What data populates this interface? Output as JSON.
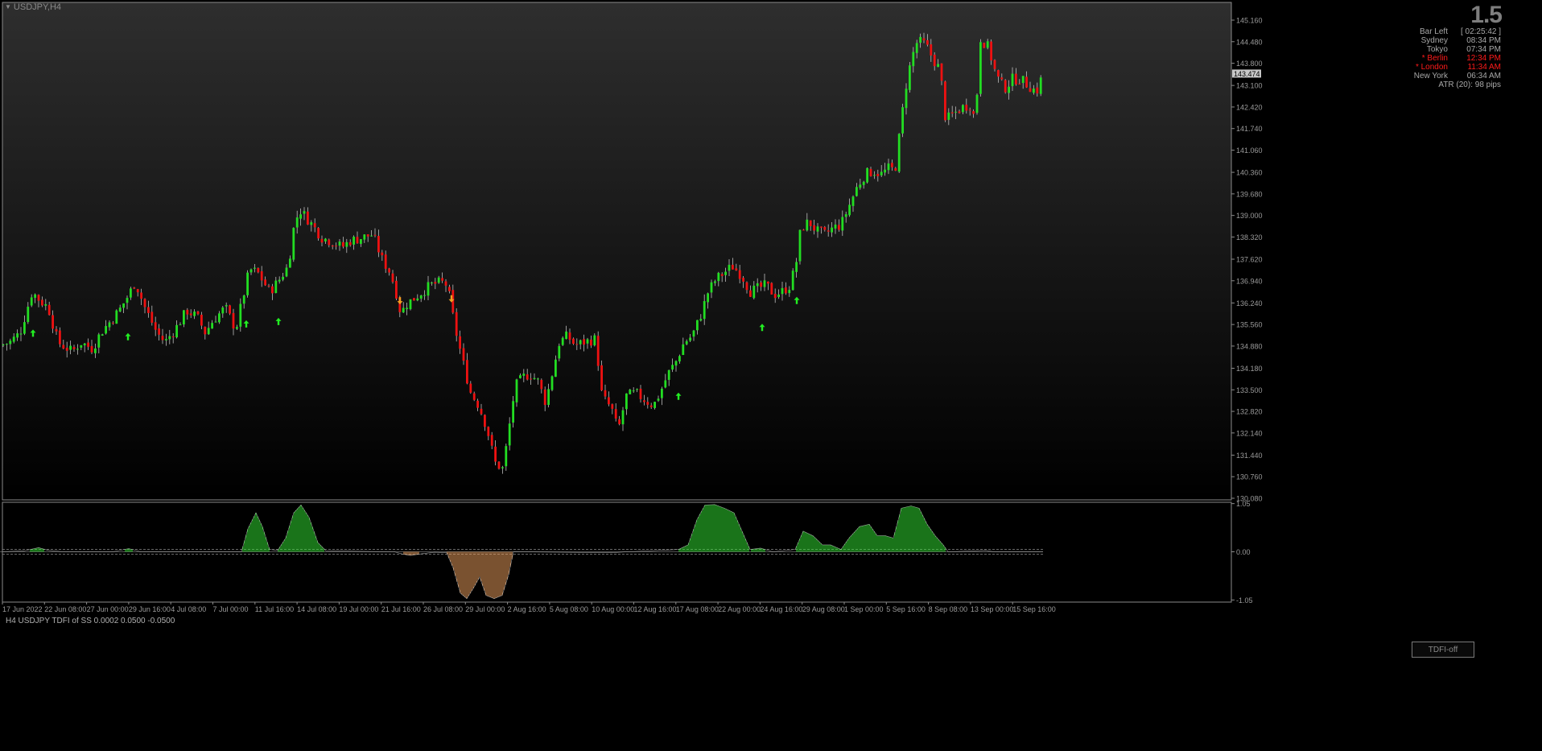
{
  "window": {
    "title": "USDJPY,H4",
    "title_icon": "dropdown-triangle-icon",
    "spread": "1.5"
  },
  "info_panel": {
    "rows": [
      {
        "label": "Bar Left",
        "value": "[ 02:25:42 ]",
        "color": "#a8a8a8"
      },
      {
        "label": "Sydney",
        "value": "08:34 PM",
        "color": "#a8a8a8"
      },
      {
        "label": "Tokyo",
        "value": "07:34 PM",
        "color": "#a8a8a8"
      },
      {
        "label": "* Berlin",
        "value": "12:34 PM",
        "color": "#ff1a1a"
      },
      {
        "label": "* London",
        "value": "11:34 AM",
        "color": "#ff1a1a"
      },
      {
        "label": "New York",
        "value": "06:34 AM",
        "color": "#a8a8a8"
      }
    ],
    "atr": "ATR (20): 98 pips"
  },
  "price_axis": {
    "labels": [
      "145.160",
      "144.480",
      "143.800",
      "143.100",
      "142.420",
      "141.740",
      "141.060",
      "140.360",
      "139.680",
      "139.000",
      "138.320",
      "137.620",
      "136.940",
      "136.240",
      "135.560",
      "134.880",
      "134.180",
      "133.500",
      "132.820",
      "132.140",
      "131.440",
      "130.760",
      "130.080"
    ],
    "current_price": "143.474"
  },
  "indicator": {
    "label": "H4 USDJPY TDFI of SS 0.0002 0.0500 -0.0500",
    "axis_labels": [
      "1.05",
      "0.00",
      "-1.05"
    ],
    "button_label": "TDFI-off",
    "positive_color": "#33e833",
    "negative_color": "#f4a460"
  },
  "time_axis": {
    "labels": [
      "17 Jun 2022",
      "22 Jun 08:00",
      "27 Jun 00:00",
      "29 Jun 16:00",
      "4 Jul 08:00",
      "7 Jul 00:00",
      "11 Jul 16:00",
      "14 Jul 08:00",
      "19 Jul 00:00",
      "21 Jul 16:00",
      "26 Jul 08:00",
      "29 Jul 00:00",
      "2 Aug 16:00",
      "5 Aug 08:00",
      "10 Aug 00:00",
      "12 Aug 16:00",
      "17 Aug 08:00",
      "22 Aug 00:00",
      "24 Aug 16:00",
      "29 Aug 08:00",
      "1 Sep 00:00",
      "5 Sep 16:00",
      "8 Sep 08:00",
      "13 Sep 00:00",
      "15 Sep 16:00"
    ]
  },
  "chart_data": {
    "type": "candlestick",
    "symbol": "USDJPY",
    "timeframe": "H4",
    "ylim": [
      130.08,
      145.16
    ],
    "up_color": "#22dd22",
    "down_color": "#ee1111",
    "close_path": [
      [
        0,
        134.9
      ],
      [
        12,
        135.0
      ],
      [
        25,
        135.3
      ],
      [
        40,
        136.6
      ],
      [
        50,
        136.3
      ],
      [
        60,
        136.1
      ],
      [
        72,
        135.0
      ],
      [
        90,
        134.7
      ],
      [
        100,
        135.0
      ],
      [
        115,
        134.8
      ],
      [
        125,
        135.3
      ],
      [
        135,
        135.6
      ],
      [
        148,
        136.0
      ],
      [
        160,
        136.5
      ],
      [
        168,
        136.9
      ],
      [
        180,
        136.1
      ],
      [
        195,
        135.3
      ],
      [
        205,
        135.0
      ],
      [
        220,
        135.5
      ],
      [
        232,
        136.0
      ],
      [
        245,
        135.8
      ],
      [
        255,
        135.3
      ],
      [
        265,
        135.7
      ],
      [
        280,
        136.1
      ],
      [
        293,
        135.4
      ],
      [
        300,
        136.2
      ],
      [
        310,
        137.3
      ],
      [
        320,
        137.2
      ],
      [
        335,
        136.6
      ],
      [
        345,
        136.9
      ],
      [
        358,
        137.4
      ],
      [
        365,
        138.6
      ],
      [
        372,
        139.2
      ],
      [
        385,
        138.8
      ],
      [
        400,
        138.3
      ],
      [
        410,
        138.2
      ],
      [
        425,
        138.0
      ],
      [
        435,
        138.2
      ],
      [
        450,
        138.3
      ],
      [
        463,
        138.4
      ],
      [
        475,
        137.6
      ],
      [
        485,
        137.2
      ],
      [
        492,
        136.6
      ],
      [
        498,
        135.9
      ],
      [
        505,
        136.2
      ],
      [
        520,
        136.5
      ],
      [
        535,
        136.8
      ],
      [
        548,
        136.9
      ],
      [
        556,
        136.8
      ],
      [
        565,
        135.5
      ],
      [
        575,
        134.4
      ],
      [
        585,
        133.4
      ],
      [
        595,
        133.0
      ],
      [
        605,
        132.3
      ],
      [
        615,
        131.2
      ],
      [
        625,
        131.0
      ],
      [
        632,
        132.2
      ],
      [
        640,
        133.6
      ],
      [
        650,
        133.9
      ],
      [
        658,
        134.0
      ],
      [
        668,
        133.8
      ],
      [
        678,
        133.1
      ],
      [
        686,
        134.0
      ],
      [
        695,
        135.0
      ],
      [
        705,
        135.2
      ],
      [
        715,
        134.9
      ],
      [
        725,
        135.0
      ],
      [
        740,
        135.1
      ],
      [
        748,
        133.3
      ],
      [
        760,
        132.9
      ],
      [
        768,
        132.2
      ],
      [
        778,
        133.3
      ],
      [
        790,
        133.4
      ],
      [
        800,
        133.2
      ],
      [
        812,
        133.0
      ],
      [
        820,
        133.4
      ],
      [
        830,
        134.0
      ],
      [
        840,
        134.4
      ],
      [
        850,
        135.0
      ],
      [
        860,
        135.2
      ],
      [
        870,
        135.8
      ],
      [
        880,
        136.6
      ],
      [
        890,
        137.0
      ],
      [
        900,
        137.2
      ],
      [
        910,
        137.4
      ],
      [
        922,
        137.1
      ],
      [
        932,
        136.6
      ],
      [
        942,
        136.7
      ],
      [
        952,
        136.8
      ],
      [
        962,
        136.5
      ],
      [
        972,
        136.6
      ],
      [
        982,
        136.8
      ],
      [
        990,
        137.6
      ],
      [
        995,
        138.6
      ],
      [
        1005,
        138.8
      ],
      [
        1015,
        138.5
      ],
      [
        1025,
        138.4
      ],
      [
        1035,
        138.6
      ],
      [
        1045,
        138.7
      ],
      [
        1055,
        139.3
      ],
      [
        1065,
        139.9
      ],
      [
        1075,
        140.3
      ],
      [
        1085,
        140.4
      ],
      [
        1095,
        140.3
      ],
      [
        1105,
        140.5
      ],
      [
        1112,
        140.4
      ],
      [
        1118,
        141.6
      ],
      [
        1125,
        143.0
      ],
      [
        1133,
        144.0
      ],
      [
        1140,
        144.5
      ],
      [
        1150,
        144.4
      ],
      [
        1160,
        143.9
      ],
      [
        1168,
        143.6
      ],
      [
        1175,
        142.0
      ],
      [
        1185,
        142.2
      ],
      [
        1195,
        142.4
      ],
      [
        1205,
        142.5
      ],
      [
        1212,
        142.0
      ],
      [
        1218,
        144.6
      ],
      [
        1228,
        144.3
      ],
      [
        1238,
        143.4
      ],
      [
        1248,
        143.0
      ],
      [
        1258,
        143.3
      ],
      [
        1268,
        143.3
      ],
      [
        1278,
        143.1
      ],
      [
        1288,
        142.9
      ],
      [
        1296,
        143.47
      ]
    ],
    "tdfi_path": [
      [
        0,
        0
      ],
      [
        30,
        0.02
      ],
      [
        48,
        0.09
      ],
      [
        60,
        0.03
      ],
      [
        80,
        0.0
      ],
      [
        140,
        0.0
      ],
      [
        160,
        0.07
      ],
      [
        175,
        0
      ],
      [
        300,
        0
      ],
      [
        308,
        0.5
      ],
      [
        318,
        0.85
      ],
      [
        326,
        0.55
      ],
      [
        335,
        0.05
      ],
      [
        345,
        0.03
      ],
      [
        355,
        0.3
      ],
      [
        365,
        0.85
      ],
      [
        374,
        1.02
      ],
      [
        384,
        0.75
      ],
      [
        395,
        0.2
      ],
      [
        405,
        0.02
      ],
      [
        490,
        0.0
      ],
      [
        500,
        -0.05
      ],
      [
        510,
        -0.08
      ],
      [
        525,
        -0.04
      ],
      [
        540,
        -0.01
      ],
      [
        555,
        -0.02
      ],
      [
        563,
        -0.35
      ],
      [
        572,
        -0.9
      ],
      [
        580,
        -1.02
      ],
      [
        588,
        -0.8
      ],
      [
        596,
        -0.55
      ],
      [
        604,
        -0.95
      ],
      [
        614,
        -1.02
      ],
      [
        624,
        -0.95
      ],
      [
        632,
        -0.5
      ],
      [
        638,
        0
      ],
      [
        760,
        -0.02
      ],
      [
        780,
        0
      ],
      [
        843,
        0.05
      ],
      [
        855,
        0.15
      ],
      [
        866,
        0.7
      ],
      [
        876,
        1.02
      ],
      [
        888,
        1.03
      ],
      [
        900,
        0.95
      ],
      [
        912,
        0.85
      ],
      [
        922,
        0.45
      ],
      [
        932,
        0.05
      ],
      [
        945,
        0.08
      ],
      [
        960,
        0.0
      ],
      [
        988,
        0.05
      ],
      [
        998,
        0.45
      ],
      [
        1010,
        0.35
      ],
      [
        1022,
        0.15
      ],
      [
        1032,
        0.15
      ],
      [
        1045,
        0.05
      ],
      [
        1055,
        0.3
      ],
      [
        1068,
        0.55
      ],
      [
        1080,
        0.6
      ],
      [
        1090,
        0.35
      ],
      [
        1100,
        0.35
      ],
      [
        1110,
        0.3
      ],
      [
        1120,
        0.95
      ],
      [
        1132,
        1.0
      ],
      [
        1142,
        0.95
      ],
      [
        1152,
        0.6
      ],
      [
        1162,
        0.35
      ],
      [
        1172,
        0.15
      ],
      [
        1178,
        0.0
      ],
      [
        1225,
        0.03
      ],
      [
        1235,
        0
      ],
      [
        1296,
        0
      ]
    ],
    "signals": [
      {
        "x": 41,
        "type": "buy"
      },
      {
        "x": 159,
        "type": "buy"
      },
      {
        "x": 306,
        "type": "buy"
      },
      {
        "x": 346,
        "type": "buy"
      },
      {
        "x": 497,
        "type": "sell"
      },
      {
        "x": 561,
        "type": "sell"
      },
      {
        "x": 843,
        "type": "buy"
      },
      {
        "x": 947,
        "type": "buy"
      },
      {
        "x": 990,
        "type": "buy"
      }
    ]
  }
}
